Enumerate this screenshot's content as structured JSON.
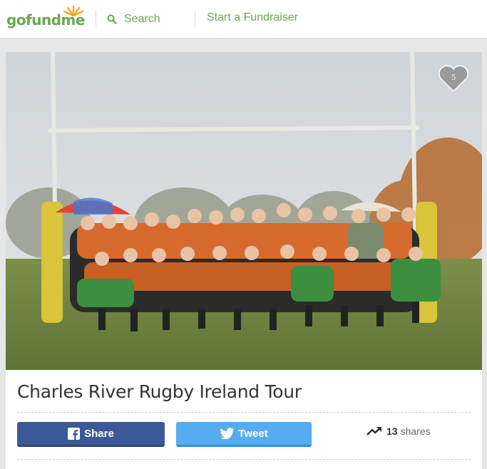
{
  "header": {
    "logo_text": "gofundme",
    "search_label": "Search",
    "start_link": "Start a Fundraiser"
  },
  "campaign": {
    "title": "Charles River Rugby Ireland Tour",
    "heart_count": "5",
    "share_button": "Share",
    "tweet_button": "Tweet",
    "shares_count": "13",
    "shares_label": "shares"
  },
  "colors": {
    "brand_green": "#6aa84f",
    "facebook_blue": "#3b5998",
    "twitter_blue": "#55acee"
  }
}
